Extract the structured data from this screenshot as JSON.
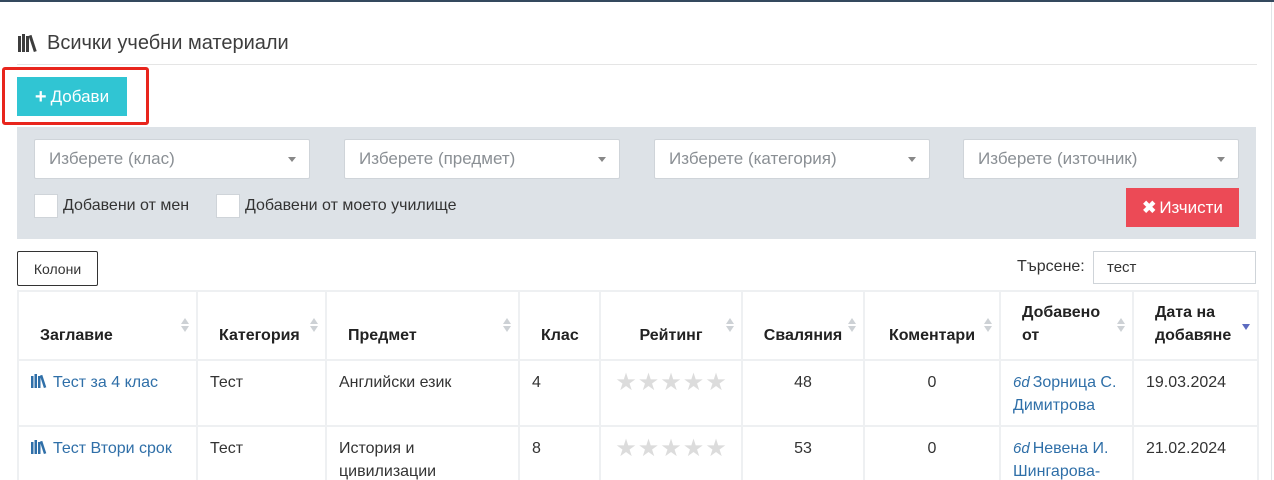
{
  "page": {
    "title": "Всички учебни материали",
    "title_icon": "books-icon"
  },
  "toolbar": {
    "add_label": "Добави"
  },
  "filters": {
    "class_placeholder": "Изберете (клас)",
    "subject_placeholder": "Изберете (предмет)",
    "category_placeholder": "Изберете (категория)",
    "source_placeholder": "Изберете (източник)",
    "added_by_me": "Добавени от мен",
    "added_by_school": "Добавени от моето училище",
    "clear_label": "Изчисти"
  },
  "table_controls": {
    "columns_label": "Колони",
    "search_label": "Търсене:",
    "search_value": "тест"
  },
  "table": {
    "headers": {
      "title": "Заглавие",
      "category": "Категория",
      "subject": "Предмет",
      "class": "Клас",
      "rating": "Рейтинг",
      "downloads": "Сваляния",
      "comments": "Коментари",
      "added_by": "Добавено от",
      "date_added": "Дата на добавяне"
    },
    "rows": [
      {
        "title": "Тест за 4 клас",
        "category": "Тест",
        "subject": "Английски език",
        "class": "4",
        "rating": 0,
        "downloads": "48",
        "comments": "0",
        "added_by": "Зорница С. Димитрова",
        "date_added": "19.03.2024"
      },
      {
        "title": "Тест Втори срок",
        "category": "Тест",
        "subject": "История и цивилизации",
        "class": "8",
        "rating": 0,
        "downloads": "53",
        "comments": "0",
        "added_by": "Невена И. Шингарова-",
        "date_added": "21.02.2024"
      }
    ]
  },
  "colors": {
    "add_button": "#30c5d3",
    "clear_button": "#ec4a56",
    "highlight": "#e8251d",
    "filter_panel": "#dde2e7",
    "link": "#2f6fa8"
  }
}
